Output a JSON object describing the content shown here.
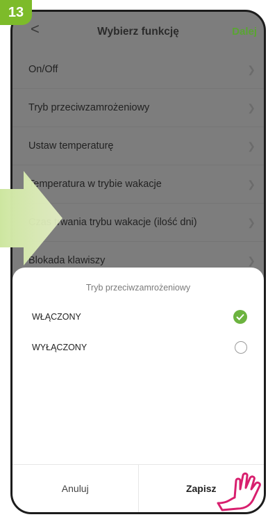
{
  "step": "13",
  "header": {
    "back": "<",
    "title": "Wybierz funkcję",
    "next": "Dalej"
  },
  "list": [
    {
      "label": "On/Off"
    },
    {
      "label": "Tryb przeciwzamrożeniowy"
    },
    {
      "label": "Ustaw temperaturę"
    },
    {
      "label": "Temperatura w trybie wakacje"
    },
    {
      "label": "Czas trwania trybu wakacje (ilość dni)"
    },
    {
      "label": "Blokada klawiszy"
    }
  ],
  "sheet": {
    "title": "Tryb przeciwzamrożeniowy",
    "options": [
      {
        "label": "WŁĄCZONY",
        "selected": true
      },
      {
        "label": "WYŁĄCZONY",
        "selected": false
      }
    ],
    "cancel": "Anuluj",
    "save": "Zapisz"
  },
  "colors": {
    "accent": "#6cb33f",
    "badge": "#7dbb2a",
    "overlay": "#7d7d7d"
  }
}
